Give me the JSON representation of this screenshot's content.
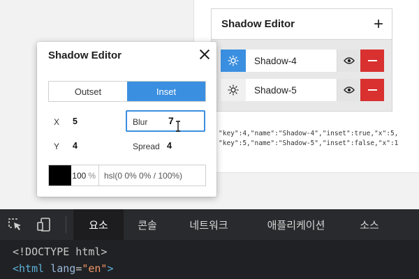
{
  "right_editor": {
    "title": "Shadow Editor",
    "add_icon": "plus-icon",
    "rows": [
      {
        "name": "Shadow-4",
        "icon": "sun-icon",
        "active": true
      },
      {
        "name": "Shadow-5",
        "icon": "sun-icon",
        "active": false
      }
    ]
  },
  "json_output": [
    "\"key\":4,\"name\":\"Shadow-4\",\"inset\":true,\"x\":5,",
    "\"key\":5,\"name\":\"Shadow-5\",\"inset\":false,\"x\":1"
  ],
  "popup": {
    "title": "Shadow Editor",
    "close_icon": "close-icon",
    "toggle": {
      "outset": "Outset",
      "inset": "Inset",
      "selected": "Inset"
    },
    "x_label": "X",
    "x_value": "5",
    "y_label": "Y",
    "y_value": "4",
    "blur_label": "Blur",
    "blur_value": "7",
    "spread_label": "Spread",
    "spread_value": "4",
    "color": {
      "swatch_hex": "#000000",
      "opacity": "100",
      "opacity_unit": "%",
      "hsl": "hsl(0 0% 0% / 100%)"
    }
  },
  "devtools": {
    "tabs": [
      "요소",
      "콘솔",
      "네트워크",
      "애플리케이션",
      "소스"
    ],
    "active_tab": "요소",
    "code_line_1": "<!DOCTYPE html>",
    "code_line_2": {
      "open": "<html",
      "attr": "lang",
      "eq": "=",
      "value": "\"en\"",
      "close": ">"
    }
  },
  "colors": {
    "accent_blue": "#3b8fe0",
    "delete_red": "#d93030",
    "devtools_bg": "#202124"
  }
}
